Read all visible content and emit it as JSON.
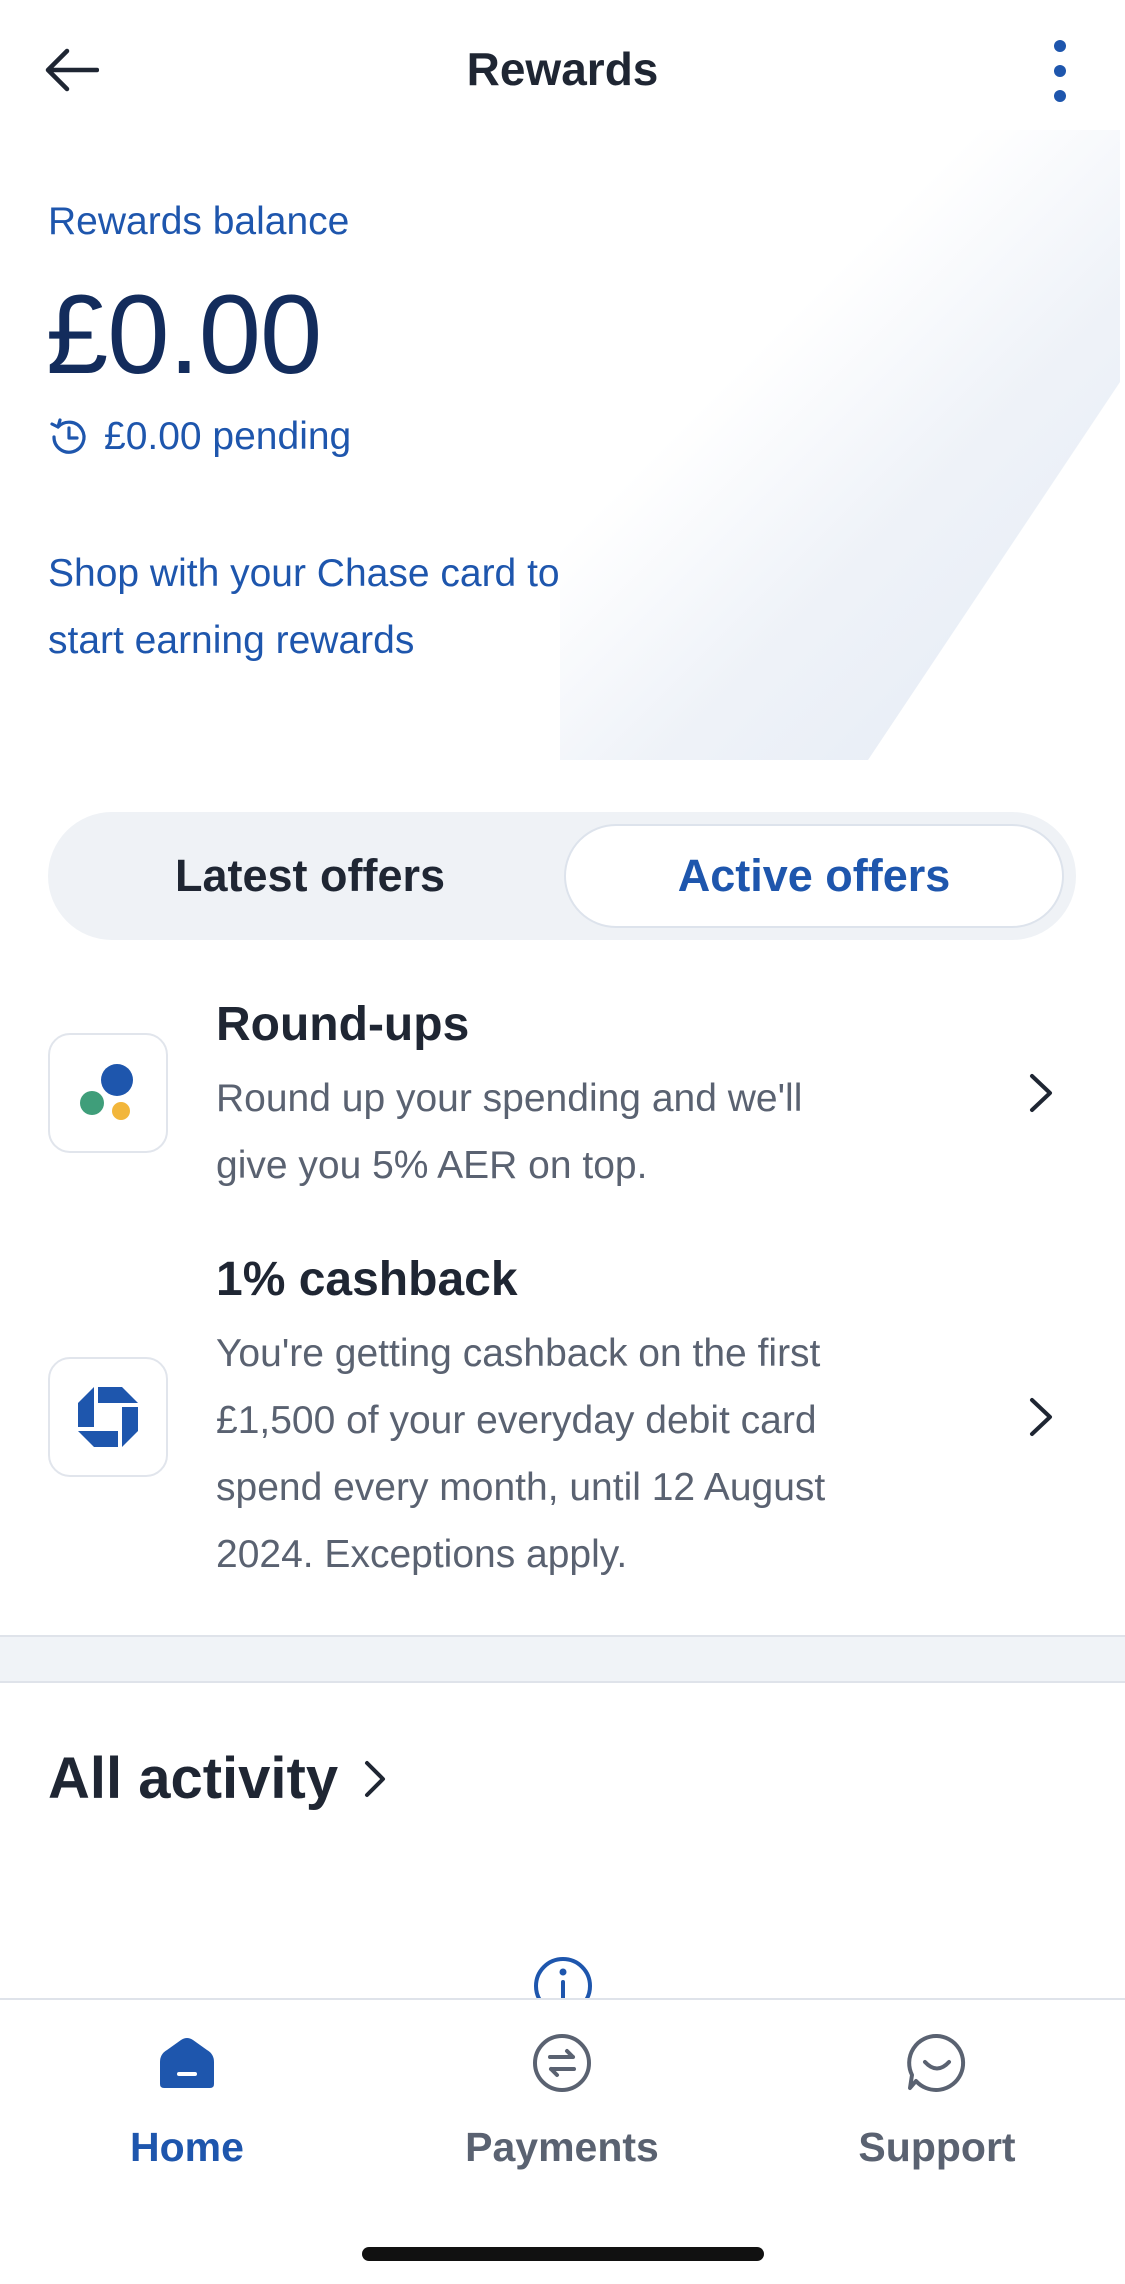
{
  "header": {
    "title": "Rewards",
    "back_icon": "arrow-left-icon",
    "more_icon": "more-vertical-icon"
  },
  "balance": {
    "label": "Rewards balance",
    "amount": "£0.00",
    "pending_icon": "clock-icon",
    "pending": "£0.00 pending"
  },
  "promo": {
    "line1": "Shop with your Chase card to",
    "line2": "start earning rewards"
  },
  "tabs": {
    "latest": "Latest offers",
    "active": "Active offers",
    "selected": "Active offers"
  },
  "offers": [
    {
      "title": "Round-ups",
      "icon": "round-ups-dots-icon",
      "desc_lines": [
        "Round up your spending and we'll",
        "give you 5% AER on top."
      ]
    },
    {
      "title": "1% cashback",
      "icon": "chase-logo-icon",
      "desc_lines": [
        "You're getting cashback on the first",
        "£1,500 of your everyday debit card",
        "spend every month, until 12 August",
        "2024. Exceptions apply."
      ]
    }
  ],
  "activity": {
    "label": "All activity"
  },
  "bottom_nav": {
    "items": [
      {
        "label": "Home",
        "icon": "home-icon",
        "active": true
      },
      {
        "label": "Payments",
        "icon": "payments-exchange-icon",
        "active": false
      },
      {
        "label": "Support",
        "icon": "chat-smile-icon",
        "active": false
      }
    ]
  },
  "colors": {
    "accent": "#1e56ad",
    "navy": "#132c5c",
    "text": "#1f2633",
    "muted": "#5a6271",
    "segment_bg": "#eff2f6"
  }
}
